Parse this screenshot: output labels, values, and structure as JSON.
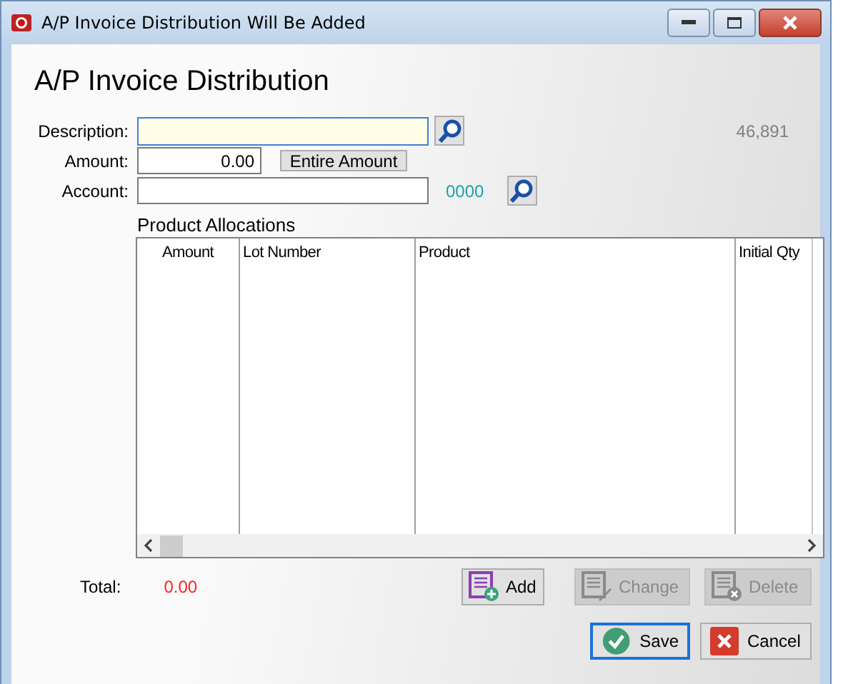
{
  "window": {
    "title": "A/P Invoice Distribution Will Be Added"
  },
  "heading": "A/P Invoice Distribution",
  "form": {
    "description": {
      "label": "Description:"
    },
    "record_number": "46,891",
    "amount": {
      "label": "Amount:",
      "value": "0.00",
      "button": "Entire Amount"
    },
    "account": {
      "label": "Account:",
      "code": "0000"
    }
  },
  "allocations": {
    "title": "Product Allocations",
    "columns": [
      {
        "label": "Amount"
      },
      {
        "label": "Lot Number"
      },
      {
        "label": "Product"
      },
      {
        "label": "Initial Qty"
      }
    ]
  },
  "total": {
    "label": "Total:",
    "value": "0.00"
  },
  "row_buttons": [
    {
      "label": "Add",
      "kind": "add",
      "disabled": false
    },
    {
      "label": "Change",
      "kind": "change",
      "disabled": true
    },
    {
      "label": "Delete",
      "kind": "delete",
      "disabled": true
    }
  ],
  "dialog_buttons": [
    {
      "label": "Save",
      "kind": "save",
      "default": true
    },
    {
      "label": "Cancel",
      "kind": "cancel",
      "default": false
    }
  ]
}
